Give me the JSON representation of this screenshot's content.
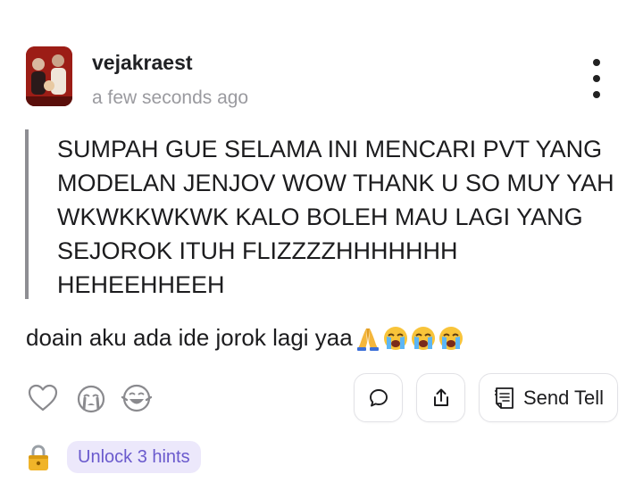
{
  "post": {
    "username": "vejakraest",
    "timestamp": "a few seconds ago",
    "quoted_message": "SUMPAH GUE SELAMA INI MENCARI PVT YANG MODELAN JENJOV WOW THANK U SO MUY YAH WKWKKWKWK KALO BOLEH MAU LAGI YANG SEJOROK ITUH FLIZZZZHHHHHHH HEHEEHHEEH",
    "reply": "doain aku ada ide jorok lagi yaa",
    "reply_emojis": [
      "folded-hands-emoji",
      "loudly-crying-emoji",
      "loudly-crying-emoji",
      "loudly-crying-emoji"
    ]
  },
  "actions": {
    "reactions": [
      "heart-icon",
      "crying-face-icon",
      "laughing-face-icon"
    ],
    "comment_icon": "speech-bubble-icon",
    "share_icon": "share-icon",
    "send_tell_label": "Send Tell",
    "send_tell_icon": "note-icon"
  },
  "hints": {
    "lock_icon": "lock-icon",
    "unlock_label": "Unlock 3 hints"
  },
  "colors": {
    "accent": "#6a5acd",
    "accent_bg": "#ece8fb",
    "muted_text": "#9a9a9f",
    "quote_bar": "#8e8e93"
  }
}
